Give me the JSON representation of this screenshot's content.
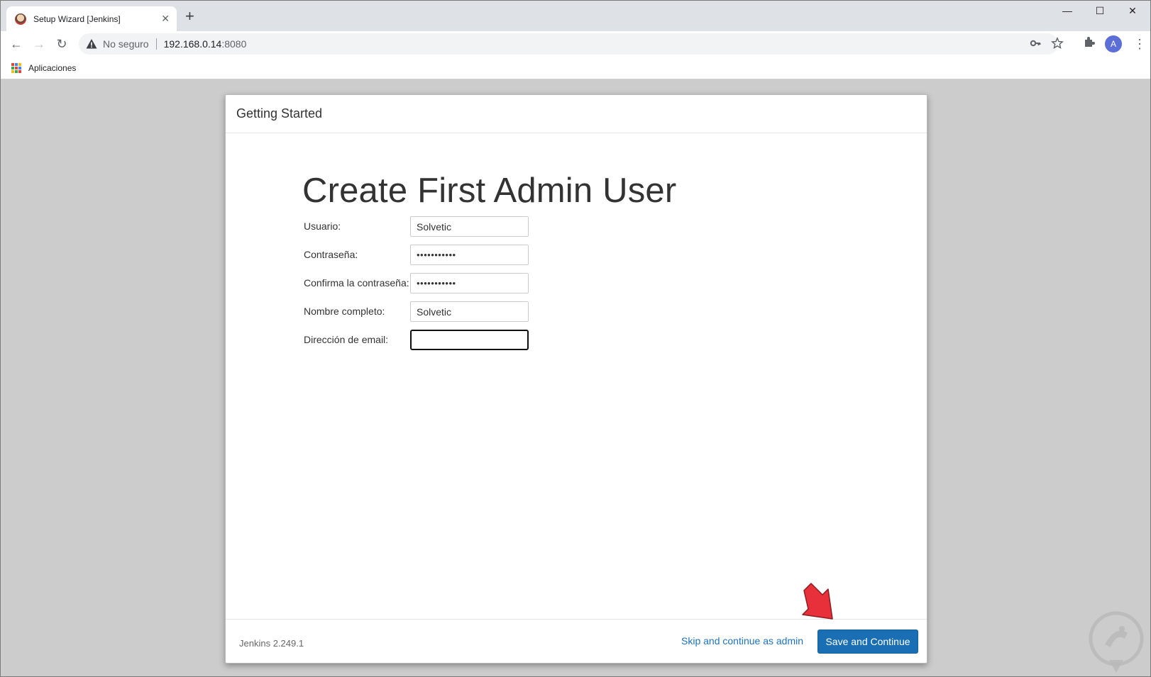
{
  "browser": {
    "tab_title": "Setup Wizard [Jenkins]",
    "tab_close": "✕",
    "new_tab": "+",
    "window_controls": {
      "minimize": "—",
      "maximize": "☐",
      "close": "✕"
    },
    "nav": {
      "back": "←",
      "forward": "→",
      "reload": "↻"
    },
    "security_label": "No seguro",
    "url_host": "192.168.0.14",
    "url_port": ":8080",
    "avatar_letter": "A",
    "menu": "⋮",
    "bookmark_label": "Aplicaciones"
  },
  "dialog": {
    "header_title": "Getting Started",
    "heading": "Create First Admin User",
    "fields": [
      {
        "label": "Usuario:",
        "value": "Solvetic",
        "type": "text"
      },
      {
        "label": "Contraseña:",
        "value": "•••••••••••",
        "type": "password"
      },
      {
        "label": "Confirma la contraseña:",
        "value": "•••••••••••",
        "type": "password"
      },
      {
        "label": "Nombre completo:",
        "value": "Solvetic",
        "type": "text"
      },
      {
        "label": "Dirección de email:",
        "value": "",
        "type": "text"
      }
    ],
    "version": "Jenkins 2.249.1",
    "skip_label": "Skip and continue as admin",
    "save_label": "Save and Continue"
  },
  "colors": {
    "primary_button": "#1a6fb4",
    "link": "#1e73be",
    "annotation_arrow": "#e8303a",
    "page_background": "#cccccc"
  }
}
